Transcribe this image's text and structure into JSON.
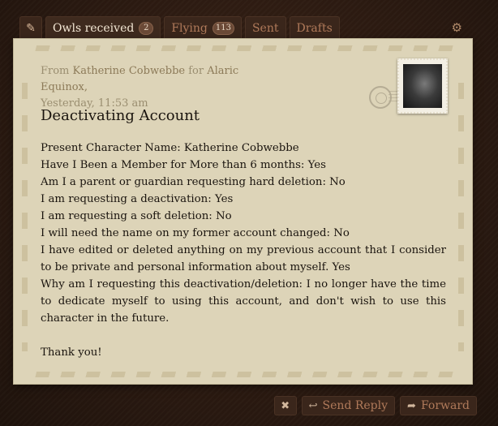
{
  "tabs": {
    "items": [
      {
        "label": "Owls received",
        "count": "2"
      },
      {
        "label": "Flying",
        "count": "113"
      },
      {
        "label": "Sent"
      },
      {
        "label": "Drafts"
      }
    ]
  },
  "letter": {
    "from_prefix": "From",
    "sender": "Katherine Cobwebbe",
    "for_prefix": "for",
    "recipient": "Alaric Equinox,",
    "timestamp": "Yesterday, 11:53 am",
    "subject": "Deactivating Account",
    "lines": [
      "Present Character Name: Katherine Cobwebbe",
      "Have I Been a Member for More than 6 months: Yes",
      "Am I a parent or guardian requesting hard deletion: No",
      "I am requesting a deactivation: Yes",
      "I am requesting a soft deletion: No",
      "I will need the name on my former account changed: No",
      "I have edited or deleted anything on my previous account that I consider to be private and personal information about myself. Yes",
      "Why am I requesting this deactivation/deletion: I no longer have the time to dedicate myself to using this account, and don't wish to use this character in the future."
    ],
    "signoff": "Thank you!"
  },
  "actions": {
    "delete_icon": "✖",
    "reply_icon": "↩",
    "reply_label": "Send Reply",
    "forward_icon": "➦",
    "forward_label": "Forward"
  },
  "icons": {
    "pencil": "pencil-icon",
    "gear": "gear-icon"
  }
}
